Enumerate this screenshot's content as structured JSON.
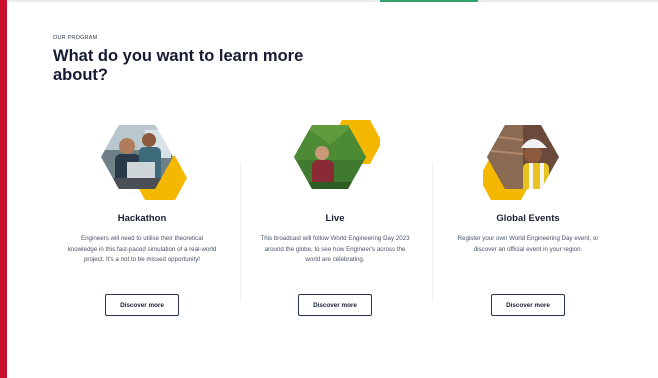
{
  "section": {
    "eyebrow": "OUR PROGRAM",
    "title": "What do you want to learn more about?"
  },
  "colors": {
    "accent_red": "#c8102e",
    "accent_yellow": "#f5b800",
    "accent_green": "#2fa36b",
    "button_border": "#2c3350"
  },
  "cards": [
    {
      "title": "Hackathon",
      "description": "Engineers will need to utilise their theoretical knowledge in this fast-paced simulation of a real-world project. It's a not to be missed opportunity!",
      "button": "Discover more",
      "image": "team-at-laptop-photo"
    },
    {
      "title": "Live",
      "description": "This broadcast will follow World Engineering Day 2023 around the globe, to see how Engineer's across the world are celebrating.",
      "button": "Discover more",
      "image": "person-in-field-photo"
    },
    {
      "title": "Global Events",
      "description": "Register your own World Engineering Day event, or discover an official event in your region.",
      "button": "Discover more",
      "image": "engineer-in-hardhat-photo"
    }
  ]
}
